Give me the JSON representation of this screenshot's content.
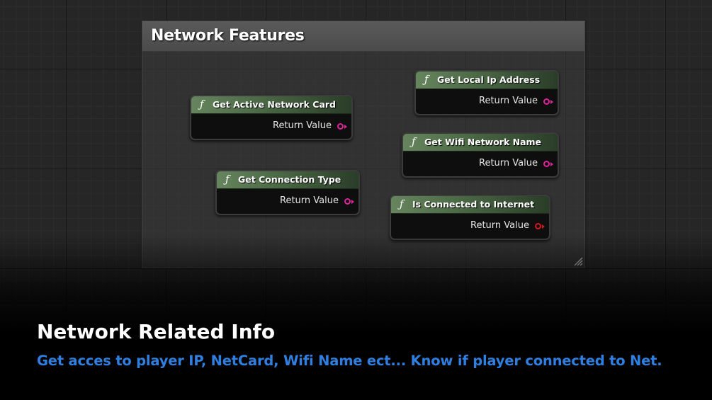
{
  "comment": {
    "title": "Network Features"
  },
  "nodes": [
    {
      "title": "Get Active Network Card",
      "output": "Return Value",
      "pin_color": "#e0249c"
    },
    {
      "title": "Get Connection Type",
      "output": "Return Value",
      "pin_color": "#e0249c"
    },
    {
      "title": "Get Local Ip Address",
      "output": "Return Value",
      "pin_color": "#e0249c"
    },
    {
      "title": "Get Wifi Network Name",
      "output": "Return Value",
      "pin_color": "#e0249c"
    },
    {
      "title": "Is Connected to Internet",
      "output": "Return Value",
      "pin_color": "#d21a1a"
    }
  ],
  "function_glyph": "ƒ",
  "caption": {
    "title": "Network Related Info",
    "subtitle": "Get acces to player IP, NetCard, Wifi Name ect... Know if player connected to Net."
  },
  "colors": {
    "node_header": "#4d6b47",
    "subtitle": "#2f7fe0",
    "background": "#262626"
  }
}
